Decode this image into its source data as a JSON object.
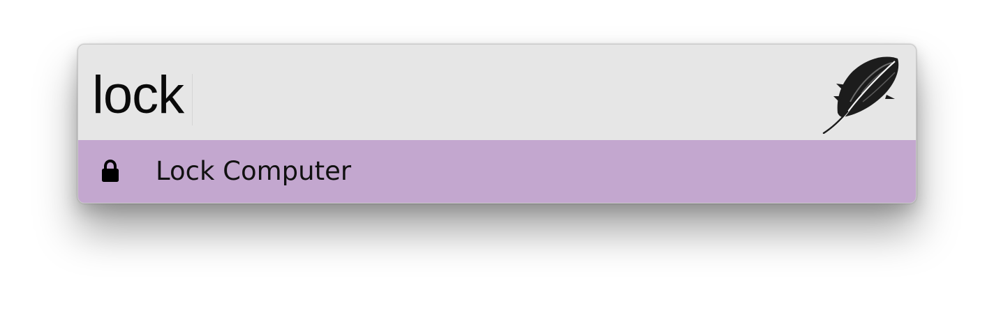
{
  "search": {
    "query": "lock",
    "logo_icon": "feather-icon"
  },
  "results": [
    {
      "label": "Lock Computer",
      "icon": "lock-icon",
      "selected": true
    }
  ],
  "colors": {
    "search_background": "#e6e6e6",
    "selected_row": "#c3a7cf",
    "text": "#111111"
  }
}
